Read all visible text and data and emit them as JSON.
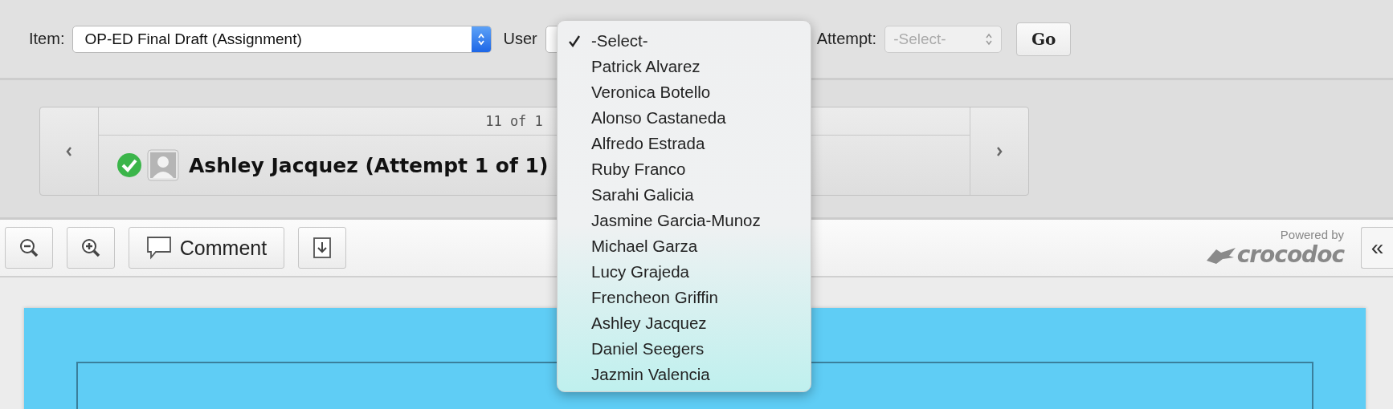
{
  "top_bar": {
    "item": {
      "label": "Item:",
      "value": "OP-ED Final Draft (Assignment)"
    },
    "user": {
      "label": "User"
    },
    "attempt": {
      "label": "Attempt:",
      "value": "-Select-",
      "disabled": true
    },
    "go_button": "Go"
  },
  "navigator": {
    "counter": "11 of 1",
    "student": "Ashley Jacquez (Attempt 1 of 1)",
    "completed": true
  },
  "viewer_toolbar": {
    "comment_button": "Comment",
    "powered_by": "Powered by",
    "brand": "crocodoc",
    "collapse_button": "«"
  },
  "user_dropdown": {
    "options": [
      {
        "label": "-Select-",
        "selected": true
      },
      {
        "label": "Patrick Alvarez",
        "selected": false
      },
      {
        "label": "Veronica Botello",
        "selected": false
      },
      {
        "label": "Alonso Castaneda",
        "selected": false
      },
      {
        "label": "Alfredo Estrada",
        "selected": false
      },
      {
        "label": "Ruby Franco",
        "selected": false
      },
      {
        "label": "Sarahi Galicia",
        "selected": false
      },
      {
        "label": "Jasmine Garcia-Munoz",
        "selected": false
      },
      {
        "label": "Michael Garza",
        "selected": false
      },
      {
        "label": "Lucy Grajeda",
        "selected": false
      },
      {
        "label": "Frencheon Griffin",
        "selected": false
      },
      {
        "label": "Ashley Jacquez",
        "selected": false
      },
      {
        "label": "Daniel Seegers",
        "selected": false
      },
      {
        "label": "Jazmin Valencia",
        "selected": false
      }
    ]
  }
}
